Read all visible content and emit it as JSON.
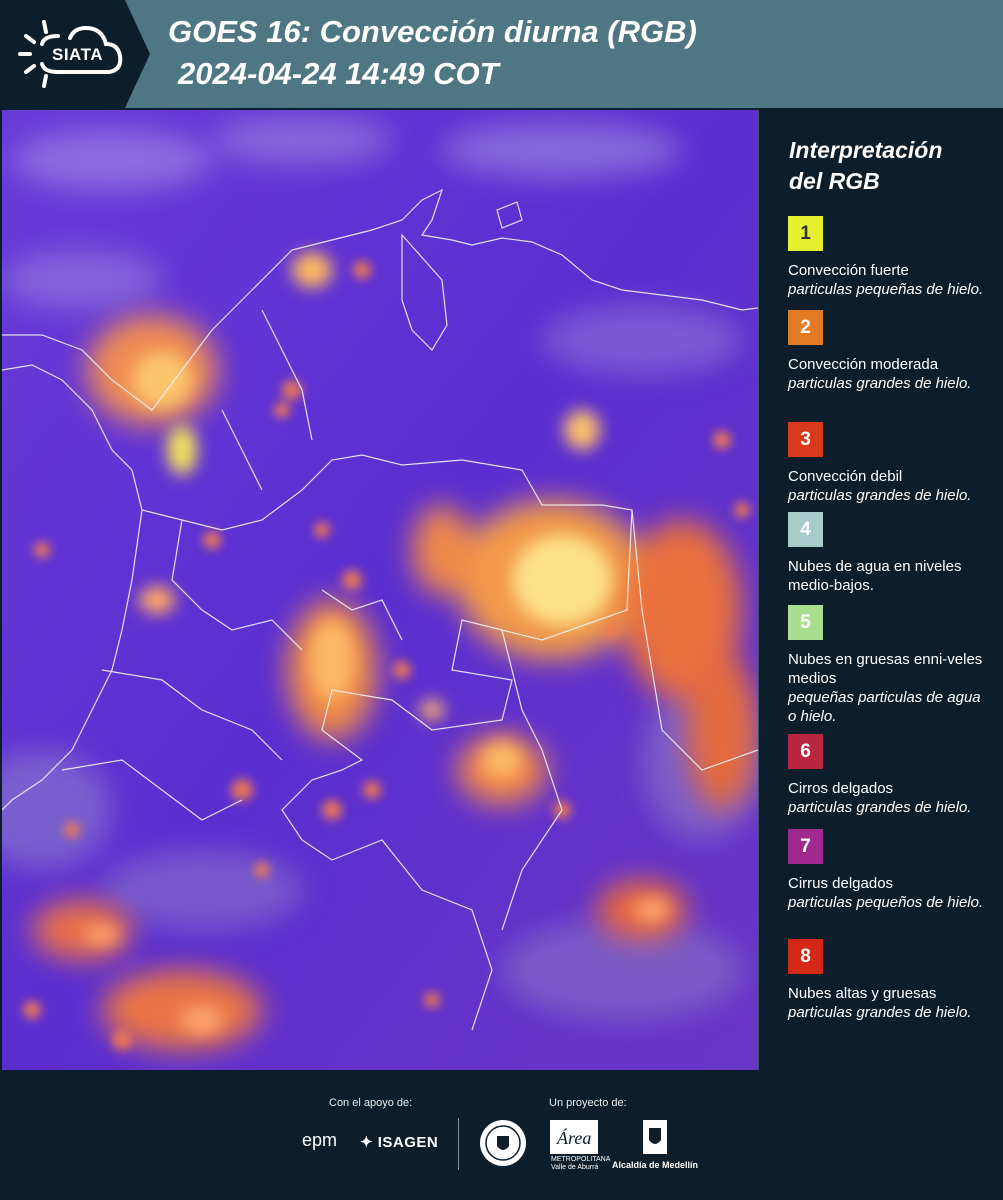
{
  "header": {
    "logo_text": "SIATA",
    "title_line1": "GOES 16: Convección diurna (RGB)",
    "title_line2": "2024-04-24 14:49 COT"
  },
  "legend": {
    "title_line1": "Interpretación",
    "title_line2": "del RGB",
    "items": [
      {
        "number": "1",
        "color": "#e6f030",
        "text_color": "#333333",
        "label": "Convección fuerte",
        "desc": "particulas pequeñas de hielo."
      },
      {
        "number": "2",
        "color": "#e27a26",
        "text_color": "#ffffff",
        "label": "Convección moderada",
        "desc": "particulas grandes de hielo."
      },
      {
        "number": "3",
        "color": "#d93a1c",
        "text_color": "#ffffff",
        "label": "Convección debil",
        "desc": "particulas grandes de hielo."
      },
      {
        "number": "4",
        "color": "#a6cbc8",
        "text_color": "#ffffff",
        "label": "Nubes de agua en niveles medio-bajos.",
        "desc": ""
      },
      {
        "number": "5",
        "color": "#a9de8e",
        "text_color": "#ffffff",
        "label": "Nubes en gruesas enni-veles medios",
        "desc": "pequeñas particulas de agua o hielo."
      },
      {
        "number": "6",
        "color": "#b8263f",
        "text_color": "#ffffff",
        "label": "Cirros delgados",
        "desc": "particulas grandes de hielo."
      },
      {
        "number": "7",
        "color": "#9e2a8f",
        "text_color": "#ffffff",
        "label": "Cirrus delgados",
        "desc": "particulas pequeños de hielo."
      },
      {
        "number": "8",
        "color": "#d42816",
        "text_color": "#ffffff",
        "label": "Nubes altas y gruesas",
        "desc": "particulas grandes de hielo."
      }
    ]
  },
  "footer": {
    "support_label": "Con el apoyo de:",
    "project_label": "Un proyecto de:",
    "epm": "epm",
    "isagen": "ISAGEN",
    "area_logo": "Área",
    "area_sub1": "METROPOLITANA",
    "area_sub2": "Valle de Aburrá",
    "alcaldia": "Alcaldía de Medellín"
  }
}
